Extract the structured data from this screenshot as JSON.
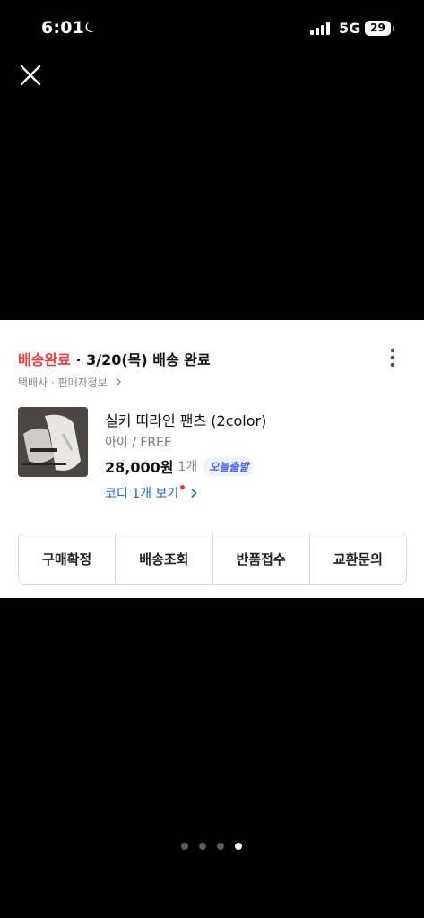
{
  "status_bar": {
    "time": "6:01",
    "network": "5G",
    "battery": "29",
    "icons": [
      "moon-icon",
      "signal-bars-icon",
      "battery-icon"
    ]
  },
  "viewer": {
    "close_icon": "close-icon"
  },
  "order_card": {
    "status_label": "배송완료",
    "delivered_text": " · 3/20(목) 배송 완료",
    "courier_text": "택배사 · 판매자정보",
    "product": {
      "name": "실키 띠라인 팬츠 (2color)",
      "option": "아이 / FREE",
      "price": "28,000원",
      "quantity": "1개",
      "delivery_badge": "오늘출발",
      "coordi_link": "코디 1개 보기"
    },
    "actions": [
      "구매확정",
      "배송조회",
      "반품접수",
      "교환문의"
    ]
  },
  "pager": {
    "count": 4,
    "active_index": 3
  },
  "colors": {
    "status_red": "#f03e3e",
    "link_blue": "#1a66d6",
    "badge_blue": "#4a63f5"
  }
}
